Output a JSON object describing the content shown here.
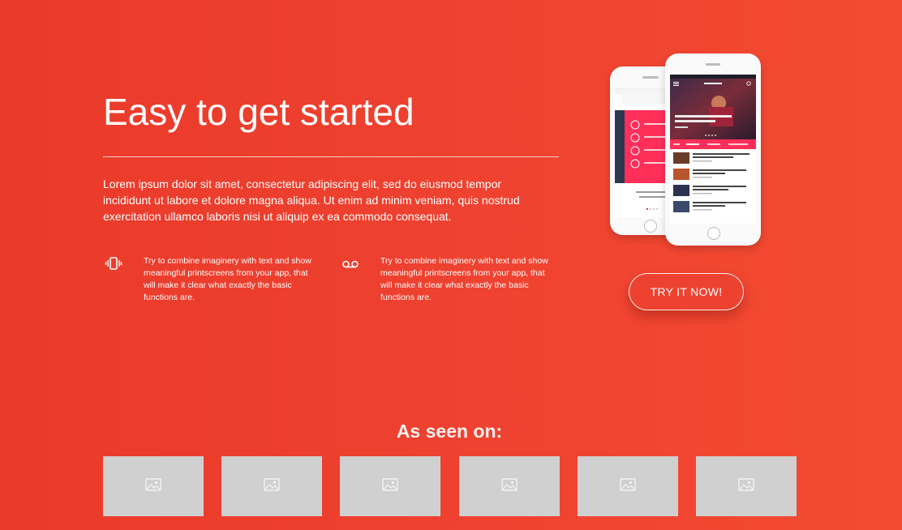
{
  "hero": {
    "title": "Easy to get started",
    "lead": "Lorem ipsum dolor sit amet, consectetur adipiscing elit, sed do eiusmod tempor incididunt ut labore et dolore magna aliqua. Ut enim ad minim veniam, quis nostrud exercitation ullamco laboris nisi ut aliquip ex ea commodo consequat."
  },
  "features": [
    {
      "icon": "vibrate-phone-icon",
      "text": "Try to combine imaginery with text and show meaningful printscreens from your app, that will make it clear what exactly the basic functions are."
    },
    {
      "icon": "voicemail-icon",
      "text": "Try to combine imaginery with text and show meaningful printscreens from your app, that will make it clear what exactly the basic functions are."
    }
  ],
  "cta": {
    "label": "TRY IT NOW!"
  },
  "seen_on": {
    "heading": "As seen on:",
    "logos": [
      "image-placeholder-icon",
      "image-placeholder-icon",
      "image-placeholder-icon",
      "image-placeholder-icon",
      "image-placeholder-icon",
      "image-placeholder-icon"
    ]
  },
  "colors": {
    "background": "#ee4230",
    "accent": "#ff2f5a",
    "placeholder": "#d0d0d0"
  }
}
